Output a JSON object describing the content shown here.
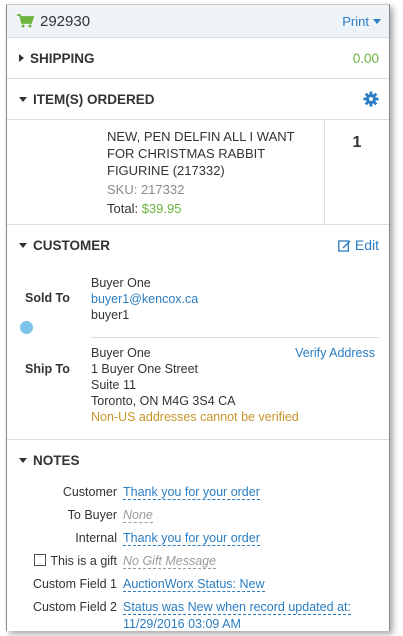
{
  "header": {
    "order_number": "292930",
    "print_label": "Print"
  },
  "shipping": {
    "title": "SHIPPING",
    "value": "0.00"
  },
  "items": {
    "title": "ITEM(S) ORDERED",
    "list": [
      {
        "name": "NEW, PEN DELFIN ALL I WANT FOR CHRISTMAS RABBIT FIGURINE (217332)",
        "sku": "SKU: 217332",
        "total_label": "Total:",
        "total_value": "$39.95",
        "qty": "1"
      }
    ]
  },
  "customer": {
    "title": "CUSTOMER",
    "edit_label": "Edit",
    "sold_to": {
      "label": "Sold To",
      "name": "Buyer One",
      "email": "buyer1@kencox.ca",
      "username": "buyer1"
    },
    "ship_to": {
      "label": "Ship To",
      "verify_label": "Verify Address",
      "name": "Buyer One",
      "line1": "1 Buyer One Street",
      "line2": "Suite 11",
      "line3": "Toronto, ON M4G 3S4 CA",
      "warning": "Non-US addresses cannot be verified"
    }
  },
  "notes": {
    "title": "NOTES",
    "customer_label": "Customer",
    "customer_value": "Thank you for your order",
    "to_buyer_label": "To Buyer",
    "to_buyer_value": "None",
    "internal_label": "Internal",
    "internal_value": "Thank you for your order",
    "gift_label": "This is a gift",
    "gift_value": "No Gift Message",
    "custom1_label": "Custom Field 1",
    "custom1_value": "AuctionWorx Status: New",
    "custom2_label": "Custom Field 2",
    "custom2_line1": "Status was New when record updated at:",
    "custom2_line2": "11/29/2016 03:09 AM"
  },
  "colors": {
    "accent": "#2a7dc2",
    "money": "#6cb33e",
    "warning": "#c8952a"
  }
}
